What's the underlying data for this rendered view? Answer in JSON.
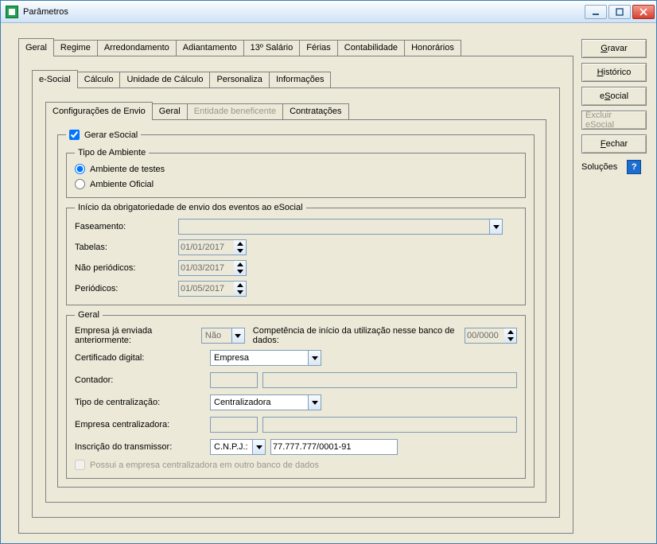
{
  "window": {
    "title": "Parâmetros"
  },
  "tabs_main": {
    "items": [
      {
        "label": "Geral",
        "selected": true
      },
      {
        "label": "Regime"
      },
      {
        "label": "Arredondamento"
      },
      {
        "label": "Adiantamento"
      },
      {
        "label": "13º Salário"
      },
      {
        "label": "Férias"
      },
      {
        "label": "Contabilidade"
      },
      {
        "label": "Honorários"
      }
    ]
  },
  "tabs_sub1": {
    "items": [
      {
        "label": "e-Social",
        "selected": true
      },
      {
        "label": "Cálculo"
      },
      {
        "label": "Unidade de Cálculo"
      },
      {
        "label": "Personaliza"
      },
      {
        "label": "Informações"
      }
    ]
  },
  "tabs_sub2": {
    "items": [
      {
        "label": "Configurações de Envio",
        "selected": true
      },
      {
        "label": "Geral"
      },
      {
        "label": "Entidade beneficente",
        "disabled": true
      },
      {
        "label": "Contratações"
      }
    ]
  },
  "gerar": {
    "checkbox_label": "Gerar eSocial",
    "checked": true,
    "tipo_ambiente": {
      "legend": "Tipo de Ambiente",
      "opt_testes": "Ambiente de testes",
      "opt_oficial": "Ambiente Oficial",
      "selected": "testes"
    }
  },
  "inicio": {
    "legend": "Início da obrigatoriedade de envio dos eventos ao eSocial",
    "faseamento_label": "Faseamento:",
    "faseamento_value": "",
    "tabelas_label": "Tabelas:",
    "tabelas_value": "01/01/2017",
    "naoper_label": "Não periódicos:",
    "naoper_value": "01/03/2017",
    "per_label": "Periódicos:",
    "per_value": "01/05/2017"
  },
  "geral": {
    "legend": "Geral",
    "empresa_ja_label": "Empresa já enviada anteriormente:",
    "empresa_ja_value": "Não",
    "competencia_label": "Competência de início da utilização nesse banco de dados:",
    "competencia_value": "00/0000",
    "cert_label": "Certificado digital:",
    "cert_value": "Empresa",
    "contador_label": "Contador:",
    "contador_value": "",
    "tipo_central_label": "Tipo de centralização:",
    "tipo_central_value": "Centralizadora",
    "empresa_central_label": "Empresa centralizadora:",
    "empresa_central_value": "",
    "inscricao_label": "Inscrição do transmissor:",
    "inscricao_tipo": "C.N.P.J.:",
    "inscricao_value": "77.777.777/0001-91",
    "possui_chk_label": "Possui a empresa centralizadora em outro banco de dados"
  },
  "right": {
    "gravar": "Gravar",
    "historico": "Histórico",
    "esocial": "eSocial",
    "excluir": "Excluir eSocial",
    "fechar": "Fechar",
    "solucoes": "Soluções"
  }
}
